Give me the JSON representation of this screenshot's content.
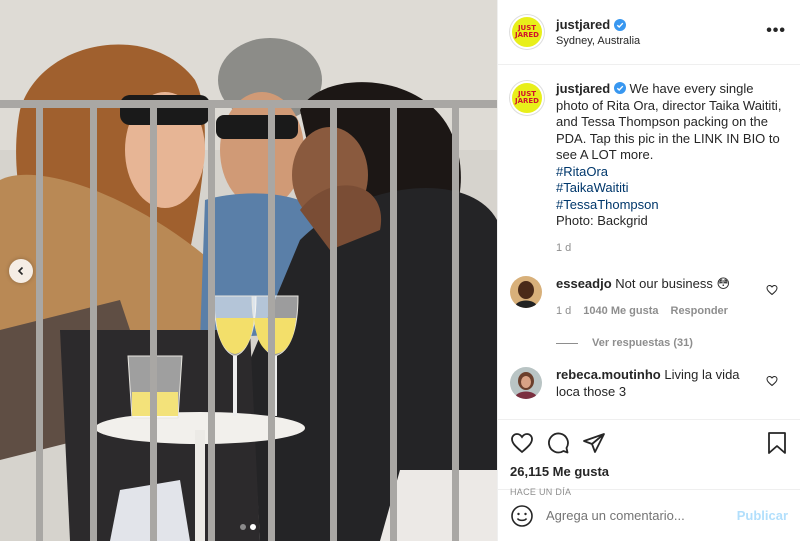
{
  "post": {
    "username": "justjared",
    "location": "Sydney, Australia",
    "avatar_text": "JUST JARED",
    "caption": "We have every single photo of Rita Ora, director Taika Waititi, and Tessa Thompson packing on the PDA. Tap this pic in the LINK IN BIO to see A LOT more.",
    "hashtags": [
      "#RitaOra",
      "#TaikaWaititi",
      "#TessaThompson"
    ],
    "photo_credit": "Photo: Backgrid",
    "caption_time": "1 d",
    "likes": "26,115 Me gusta",
    "posted_ago": "HACE UN DÍA"
  },
  "comments": [
    {
      "username": "esseadjo",
      "text": "Not our business 😳",
      "time": "1 d",
      "likes": "1040 Me gusta",
      "reply_label": "Responder",
      "view_replies": "Ver respuestas (31)"
    },
    {
      "username": "rebeca.moutinho",
      "text": "Living la vida loca those 3"
    }
  ],
  "add_comment": {
    "placeholder": "Agrega un comentario...",
    "publish_label": "Publicar"
  },
  "carousel": {
    "total": 2,
    "active": 2
  },
  "icons": {
    "more": "more-options-icon",
    "like": "heart-icon",
    "comment": "comment-icon",
    "share": "send-icon",
    "save": "bookmark-icon",
    "emoji": "emoji-icon",
    "prev": "chevron-left-icon"
  },
  "colors": {
    "accent_link": "#00376b",
    "verified": "#3897f0",
    "publish_disabled": "#b2dffc",
    "logo_bg": "#e8ef1a",
    "logo_text": "#d0122c"
  }
}
